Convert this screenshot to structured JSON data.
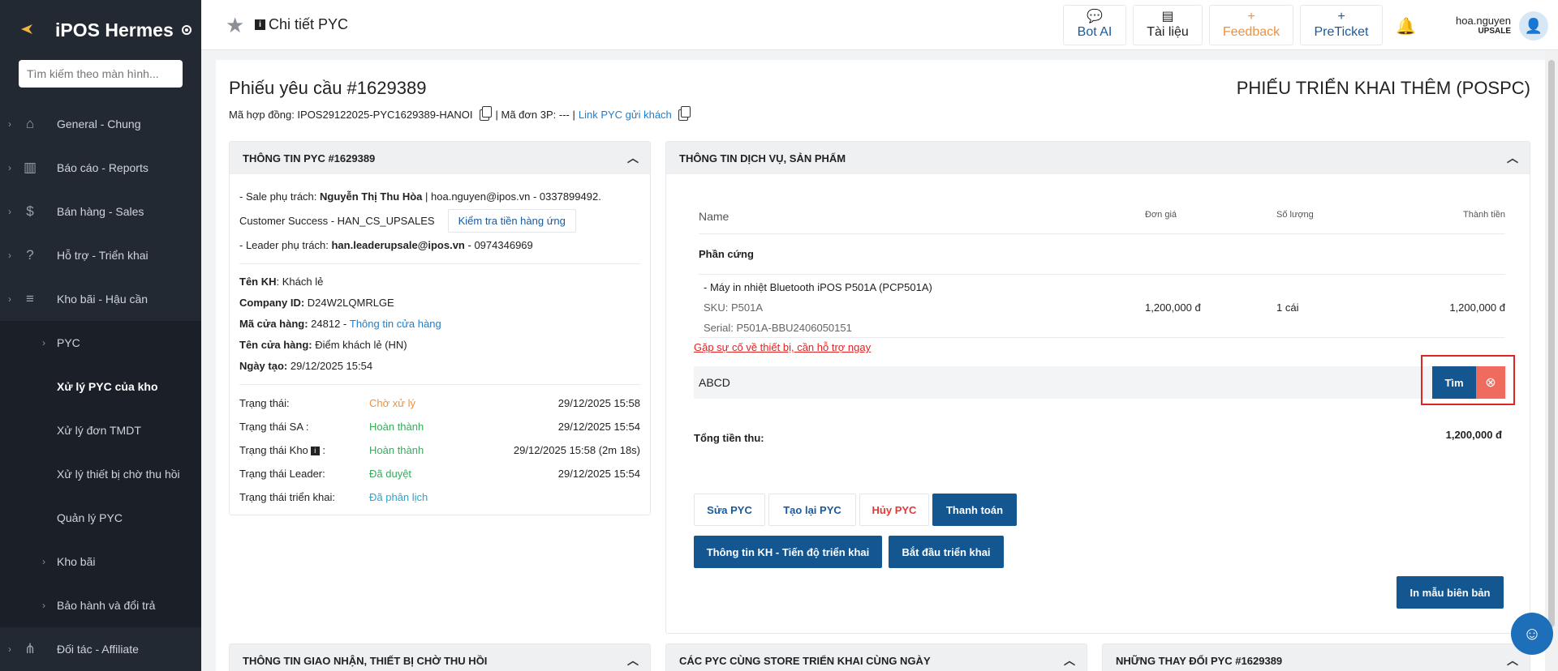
{
  "sidebar": {
    "brand": "iPOS Hermes",
    "search_placeholder": "Tìm kiếm theo màn hình...",
    "items": [
      {
        "label": "General - Chung",
        "icon": "home-icon"
      },
      {
        "label": "Báo cáo - Reports",
        "icon": "bar-chart-icon"
      },
      {
        "label": "Bán hàng - Sales",
        "icon": "dollar-icon"
      },
      {
        "label": "Hỗ trợ - Triển khai",
        "icon": "help-icon"
      },
      {
        "label": "Kho bãi - Hậu cần",
        "icon": "stack-icon"
      }
    ],
    "subitems": [
      {
        "label": "PYC",
        "has_chevron": true
      },
      {
        "label": "Xử lý PYC của kho",
        "has_chevron": false,
        "active": true
      },
      {
        "label": "Xử lý đơn TMDT",
        "has_chevron": false
      },
      {
        "label": "Xử lý thiết bị chờ thu hồi",
        "has_chevron": false
      },
      {
        "label": "Quản lý PYC",
        "has_chevron": false
      },
      {
        "label": "Kho bãi",
        "has_chevron": true
      },
      {
        "label": "Bảo hành và đổi trả",
        "has_chevron": true
      }
    ],
    "last_item": {
      "label": "Đối tác - Affiliate",
      "icon": "network-icon"
    }
  },
  "header": {
    "title": "Chi tiết PYC",
    "buttons": [
      {
        "label": "Bot AI",
        "icon": "chat-icon",
        "color": "#1a5a9c"
      },
      {
        "label": "Tài liệu",
        "icon": "document-icon",
        "color": "#222222"
      },
      {
        "label": "Feedback",
        "icon": "+",
        "color": "#f0903a"
      },
      {
        "label": "PreTicket",
        "icon": "+",
        "color": "#1a5a9c"
      }
    ],
    "user_name": "hoa.nguyen",
    "user_role": "UPSALE"
  },
  "page": {
    "title": "Phiếu yêu cầu #1629389",
    "type": "PHIẾU TRIỂN KHAI THÊM (POSPC)",
    "contract_label": "Mã hợp đồng: IPOS29122025-PYC1629389-HANOI",
    "third_party": "| Mã đơn 3P: --- |",
    "link_label": "Link PYC gửi khách"
  },
  "pyc": {
    "header": "THÔNG TIN PYC #1629389",
    "sale_prefix": "- Sale phụ trách:",
    "sale_name": "Nguyễn Thị Thu Hòa",
    "sale_contact": "| hoa.nguyen@ipos.vn - 0337899492.",
    "cs": "Customer Success - HAN_CS_UPSALES",
    "check_button": "Kiểm tra tiền hàng ứng",
    "leader_prefix": "- Leader phụ trách:",
    "leader_email": "han.leaderupsale@ipos.vn",
    "leader_phone": "- 0974346969",
    "customer_label": "Tên KH",
    "customer_value": ": Khách lẻ",
    "company_label": "Company ID:",
    "company_value": "D24W2LQMRLGE",
    "store_code_label": "Mã cửa hàng:",
    "store_code_value": "24812 -",
    "store_link": "Thông tin cửa hàng",
    "store_name_label": "Tên cửa hàng:",
    "store_name_value": "Điểm khách lẻ (HN)",
    "created_label": "Ngày tạo:",
    "created_value": "29/12/2025 15:54",
    "statuses": [
      {
        "label": "Trạng thái:",
        "value": "Chờ xử lý",
        "color": "#f0903a",
        "time": "29/12/2025 15:58"
      },
      {
        "label": "Trạng thái SA :",
        "value": "Hoàn thành",
        "color": "#3aaa5c",
        "time": "29/12/2025 15:54"
      },
      {
        "label": "Trạng thái Kho",
        "value": "Hoàn thành",
        "color": "#3aaa5c",
        "time": "29/12/2025 15:58 (2m 18s)"
      },
      {
        "label": "Trạng thái Leader:",
        "value": "Đã duyệt",
        "color": "#3aaa5c",
        "time": "29/12/2025 15:54"
      },
      {
        "label": "Trạng thái triển khai:",
        "value": "Đã phân lịch",
        "color": "#2aa6c9",
        "time": ""
      }
    ]
  },
  "service": {
    "header": "THÔNG TIN DỊCH VỤ, SẢN PHẨM",
    "columns": {
      "name": "Name",
      "price": "Đơn giá",
      "qty": "Số lượng",
      "total": "Thành tiền"
    },
    "group": "Phần cứng",
    "product": {
      "name": "- Máy in nhiệt Bluetooth iPOS P501A (PCP501A)",
      "sku": "SKU: P501A",
      "serial": "Serial: P501A-BBU2406050151",
      "price": "1,200,000 đ",
      "qty": "1 cái",
      "total": "1,200,000 đ"
    },
    "issue_link": "Gặp sự cố về thiết bị, cần hỗ trợ ngay",
    "search_value": "ABCD",
    "search_button": "Tìm",
    "total_label": "Tổng tiền thu:",
    "total_value": "1,200,000 đ",
    "actions": [
      {
        "label": "Sửa PYC",
        "color": "#1a5a9c"
      },
      {
        "label": "Tạo lại PYC",
        "color": "#1a5a9c"
      },
      {
        "label": "Hủy PYC",
        "color": "#e53935"
      },
      {
        "label": "Thanh toán",
        "primary": true
      }
    ],
    "actions2": [
      {
        "label": "Thông tin KH - Tiến độ triển khai"
      },
      {
        "label": "Bắt đầu triển khai"
      }
    ],
    "print_button": "In mẫu biên bản"
  },
  "bottom_cards": [
    {
      "header": "THÔNG TIN GIAO NHẬN, THIẾT BỊ CHỜ THU HỒI"
    },
    {
      "header": "CÁC PYC CÙNG STORE TRIỂN KHAI CÙNG NGÀY"
    },
    {
      "header": "NHỮNG THAY ĐỔI PYC #1629389"
    }
  ],
  "colors": {
    "sidebar_bg": "#232933",
    "primary": "#14568f",
    "highlight_box": "#e02424",
    "danger_button": "#ef6b5e"
  }
}
